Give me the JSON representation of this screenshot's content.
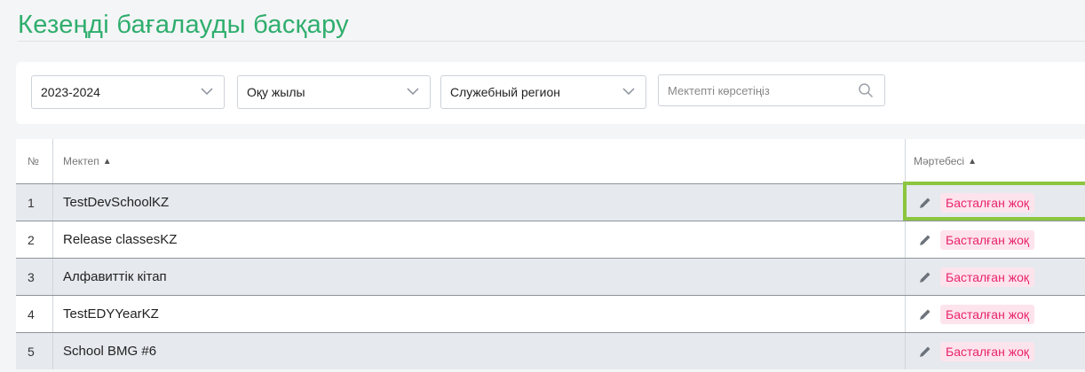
{
  "page": {
    "title": "Кезеңді бағалауды басқару"
  },
  "filters": {
    "year": "2023-2024",
    "period": "Оқу жылы",
    "region": "Служебный регион",
    "search_placeholder": "Мектепті көрсетіңіз"
  },
  "table": {
    "headers": {
      "num": "№",
      "school": "Мектеп",
      "status": "Мәртебесі"
    },
    "rows": [
      {
        "num": "1",
        "school": "TestDevSchoolKZ",
        "status": "Басталған жоқ"
      },
      {
        "num": "2",
        "school": "Release classesKZ",
        "status": "Басталған жоқ"
      },
      {
        "num": "3",
        "school": "Алфавиттік кітап",
        "status": "Басталған жоқ"
      },
      {
        "num": "4",
        "school": "TestEDYYearKZ",
        "status": "Басталған жоқ"
      },
      {
        "num": "5",
        "school": "School BMG #6",
        "status": "Басталған жоқ"
      }
    ]
  },
  "colors": {
    "title": "#2fae6d",
    "status_badge_text": "#e8246b",
    "status_badge_bg": "#fde4ec",
    "shaded_row": "#e6e9ee",
    "highlight": "#8cc63f"
  },
  "icons": {
    "dropdown": "chevron-down-icon",
    "search": "search-icon",
    "edit": "pencil-icon",
    "sort_both": "sort-icon",
    "sort_asc": "sort-asc-icon"
  }
}
